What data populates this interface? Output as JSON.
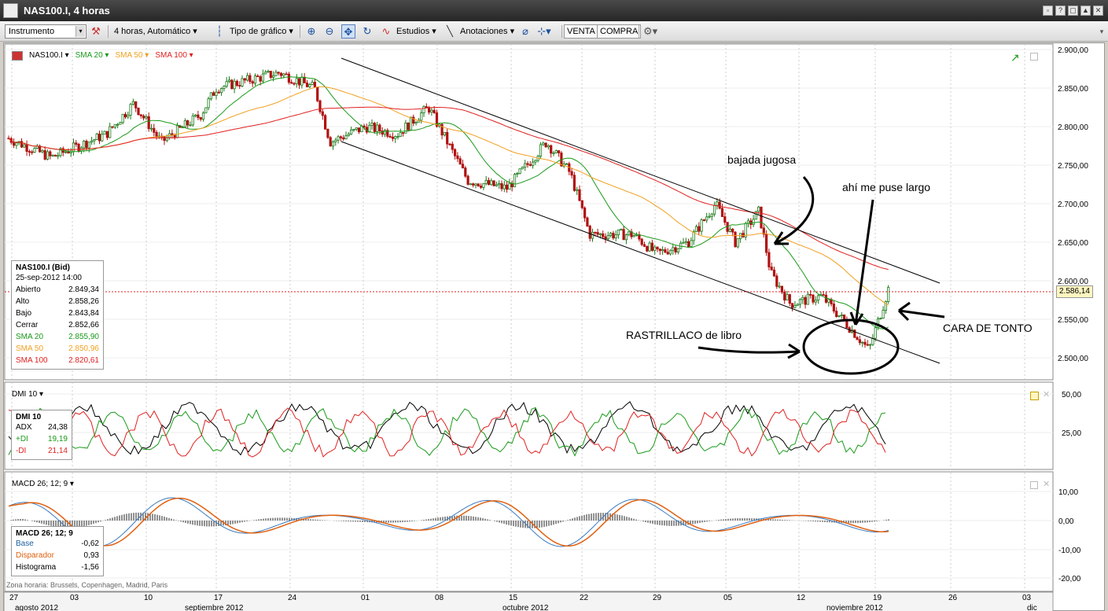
{
  "window": {
    "title": "NAS100.I, 4 horas"
  },
  "toolbar": {
    "instrument_value": "Instrumento",
    "timeframe": "4 horas,  Automático",
    "chart_type": "Tipo de gráfico",
    "studies": "Estudios",
    "annotations": "Anotaciones",
    "sell": "VENTA",
    "buy": "COMPRA"
  },
  "main_panel": {
    "symbol": "NAS100.I",
    "sma20_label": "SMA 20",
    "sma50_label": "SMA 50",
    "sma100_label": "SMA 100",
    "current_price": "2.586,14",
    "yaxis": [
      "2.900,00",
      "2.850,00",
      "2.800,00",
      "2.750,00",
      "2.700,00",
      "2.650,00",
      "2.600,00",
      "2.550,00",
      "2.500,00"
    ],
    "info": {
      "header": "NAS100.I (Bid)",
      "date": "25-sep-2012 14:00",
      "rows": [
        {
          "k": "Abierto",
          "v": "2.849,34"
        },
        {
          "k": "Alto",
          "v": "2.858,26"
        },
        {
          "k": "Bajo",
          "v": "2.843,84"
        },
        {
          "k": "Cerrar",
          "v": "2.852,66"
        },
        {
          "k": "SMA 20",
          "v": "2.855,90"
        },
        {
          "k": "SMA 50",
          "v": "2.850,96"
        },
        {
          "k": "SMA 100",
          "v": "2.820,61"
        }
      ]
    },
    "annotations": {
      "a1": "bajada jugosa",
      "a2": "ahí me puse largo",
      "a3": "RASTRILLACO de libro",
      "a4": "CARA DE TONTO"
    }
  },
  "dmi_panel": {
    "label": "DMI 10",
    "yaxis": [
      "50,00",
      "25,00"
    ],
    "info": {
      "header": "DMI 10",
      "rows": [
        {
          "k": "ADX",
          "v": "24,38"
        },
        {
          "k": "+DI",
          "v": "19,19"
        },
        {
          "k": "-DI",
          "v": "21,14"
        }
      ]
    }
  },
  "macd_panel": {
    "label": "MACD 26; 12; 9",
    "yaxis": [
      "10,00",
      "0,00",
      "-10,00",
      "-20,00"
    ],
    "info": {
      "header": "MACD 26; 12; 9",
      "rows": [
        {
          "k": "Base",
          "v": "-0,62"
        },
        {
          "k": "Disparador",
          "v": "0,93"
        },
        {
          "k": "Histograma",
          "v": "-1,56"
        }
      ]
    },
    "timezone": "Zona horaria: Brussels, Copenhagen, Madrid, Paris"
  },
  "xaxis": {
    "days": [
      "27",
      "03",
      "10",
      "17",
      "24",
      "01",
      "08",
      "15",
      "22",
      "29",
      "05",
      "12",
      "19",
      "26",
      "03"
    ],
    "months": [
      "agosto 2012",
      "septiembre 2012",
      "octubre 2012",
      "noviembre 2012",
      "dic"
    ]
  },
  "colors": {
    "sma20": "#1a9a1a",
    "sma50": "#f0a020",
    "sma100": "#e02020",
    "bull": "#1a7a1a",
    "bear": "#b01010"
  }
}
